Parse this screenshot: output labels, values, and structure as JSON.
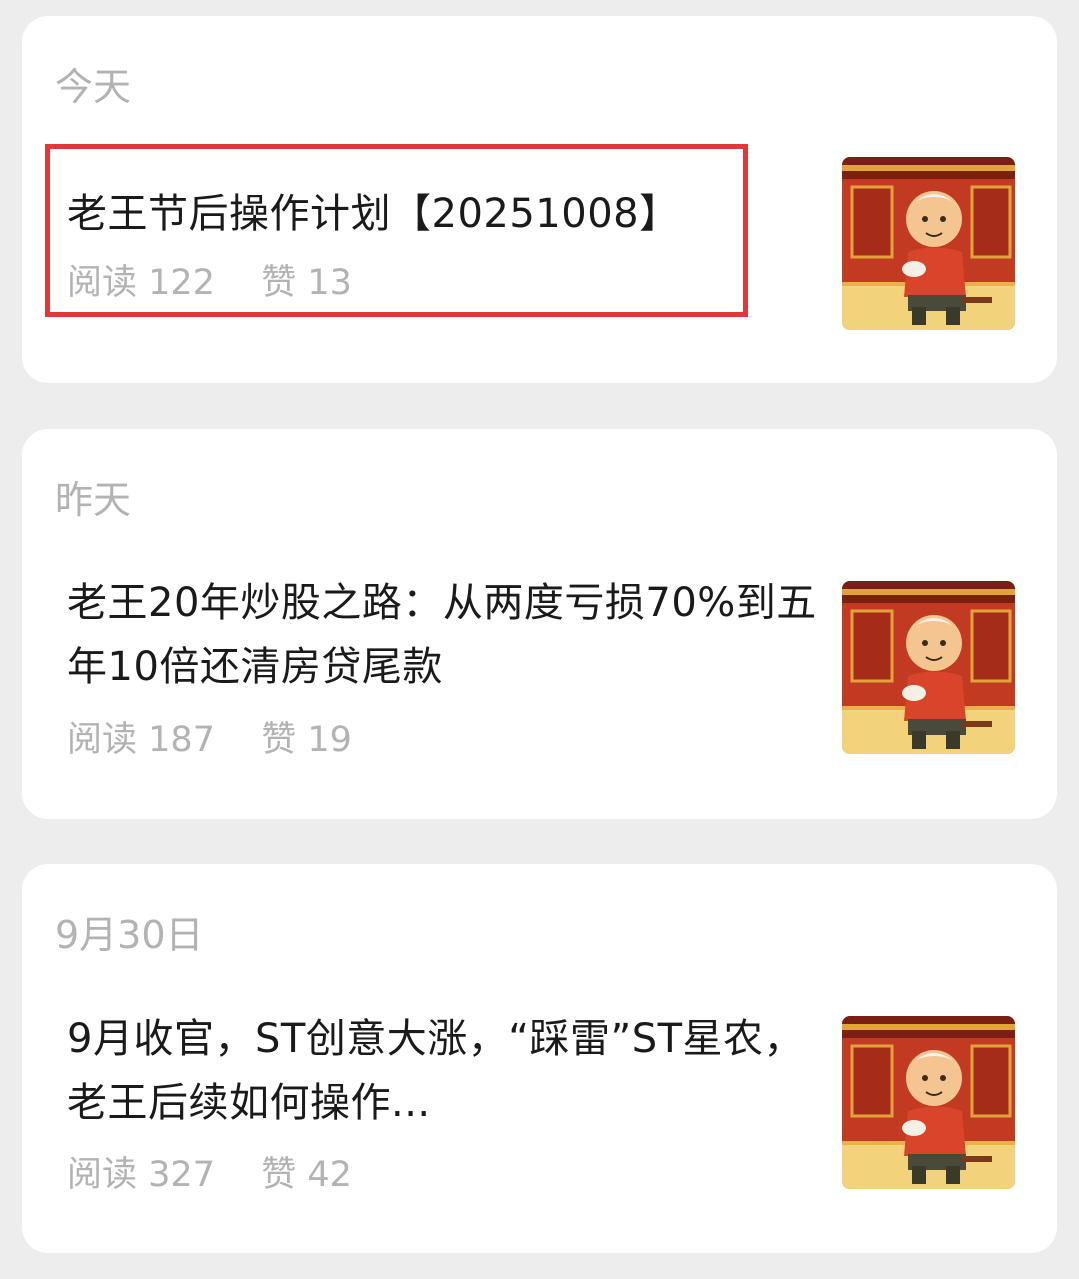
{
  "feed": [
    {
      "date": "今天",
      "title": "老王节后操作计划【20251008】",
      "reads_label": "阅读",
      "reads": "122",
      "likes_label": "赞",
      "likes": "13",
      "highlighted": true
    },
    {
      "date": "昨天",
      "title": "老王20年炒股之路：从两度亏损70%到五年10倍还清房贷尾款",
      "reads_label": "阅读",
      "reads": "187",
      "likes_label": "赞",
      "likes": "19"
    },
    {
      "date": "9月30日",
      "title": "9月收官，ST创意大涨，“踩雷”ST星农，老王后续如何操作...",
      "reads_label": "阅读",
      "reads": "327",
      "likes_label": "赞",
      "likes": "42"
    }
  ],
  "colors": {
    "background": "#ededed",
    "card": "#ffffff",
    "highlight_border": "#e0373b",
    "muted_text": "#b3b3b3",
    "title_text": "#1a1a1a"
  },
  "icons": {
    "thumbnail": "old-man-tea-illustration"
  }
}
